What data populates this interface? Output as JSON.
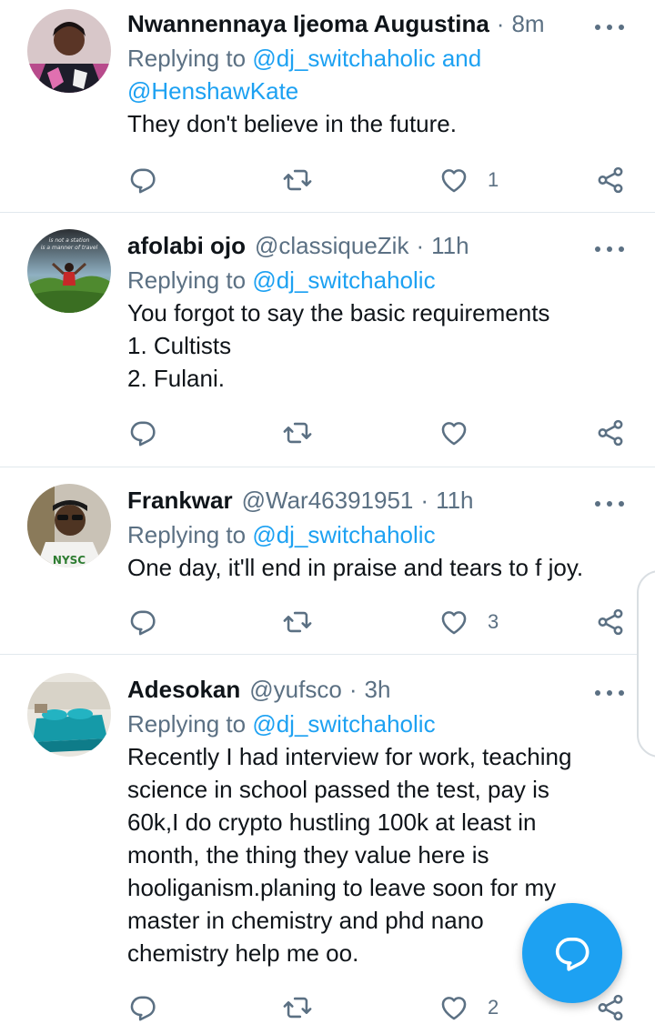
{
  "labels": {
    "replying_prefix": "Replying to",
    "and_word": "and"
  },
  "tweets": [
    {
      "name": "Nwannennaya Ijeoma Augustina",
      "handle": "",
      "time": "8m",
      "replying_to": [
        "@dj_switchaholic",
        "@HenshawKate"
      ],
      "text": "They don't believe in the future.",
      "likes": "1"
    },
    {
      "name": "afolabi ojo",
      "handle": "@classiqueZik",
      "time": "11h",
      "replying_to": [
        "@dj_switchaholic"
      ],
      "text": "You forgot to say the basic requirements\n1. Cultists\n2. Fulani.",
      "likes": ""
    },
    {
      "name": "Frankwar",
      "handle": "@War46391951",
      "time": "11h",
      "replying_to": [
        "@dj_switchaholic"
      ],
      "text": "One day, it'll end in praise and tears to f joy.",
      "likes": "3"
    },
    {
      "name": "Adesokan",
      "handle": "@yufsco",
      "time": "3h",
      "replying_to": [
        "@dj_switchaholic"
      ],
      "text": "Recently I had interview for work, teaching\nscience in school passed the test, pay is\n60k,I do crypto hustling 100k at least in\nmonth, the thing they value here is\nhooliganism.planing to leave soon for my\nmaster in chemistry and phd nano\nchemistry help me oo.",
      "likes": "2"
    }
  ],
  "avatar_text": {
    "afolabi": "is not a station / is a manner of travel"
  },
  "colors": {
    "accent": "#1da1f2",
    "muted": "#5b7083",
    "text": "#0f1419",
    "divider": "#e1e8ed"
  },
  "icons": [
    "reply-icon",
    "retweet-icon",
    "like-icon",
    "share-icon",
    "more-icon",
    "compose-reply-icon"
  ]
}
